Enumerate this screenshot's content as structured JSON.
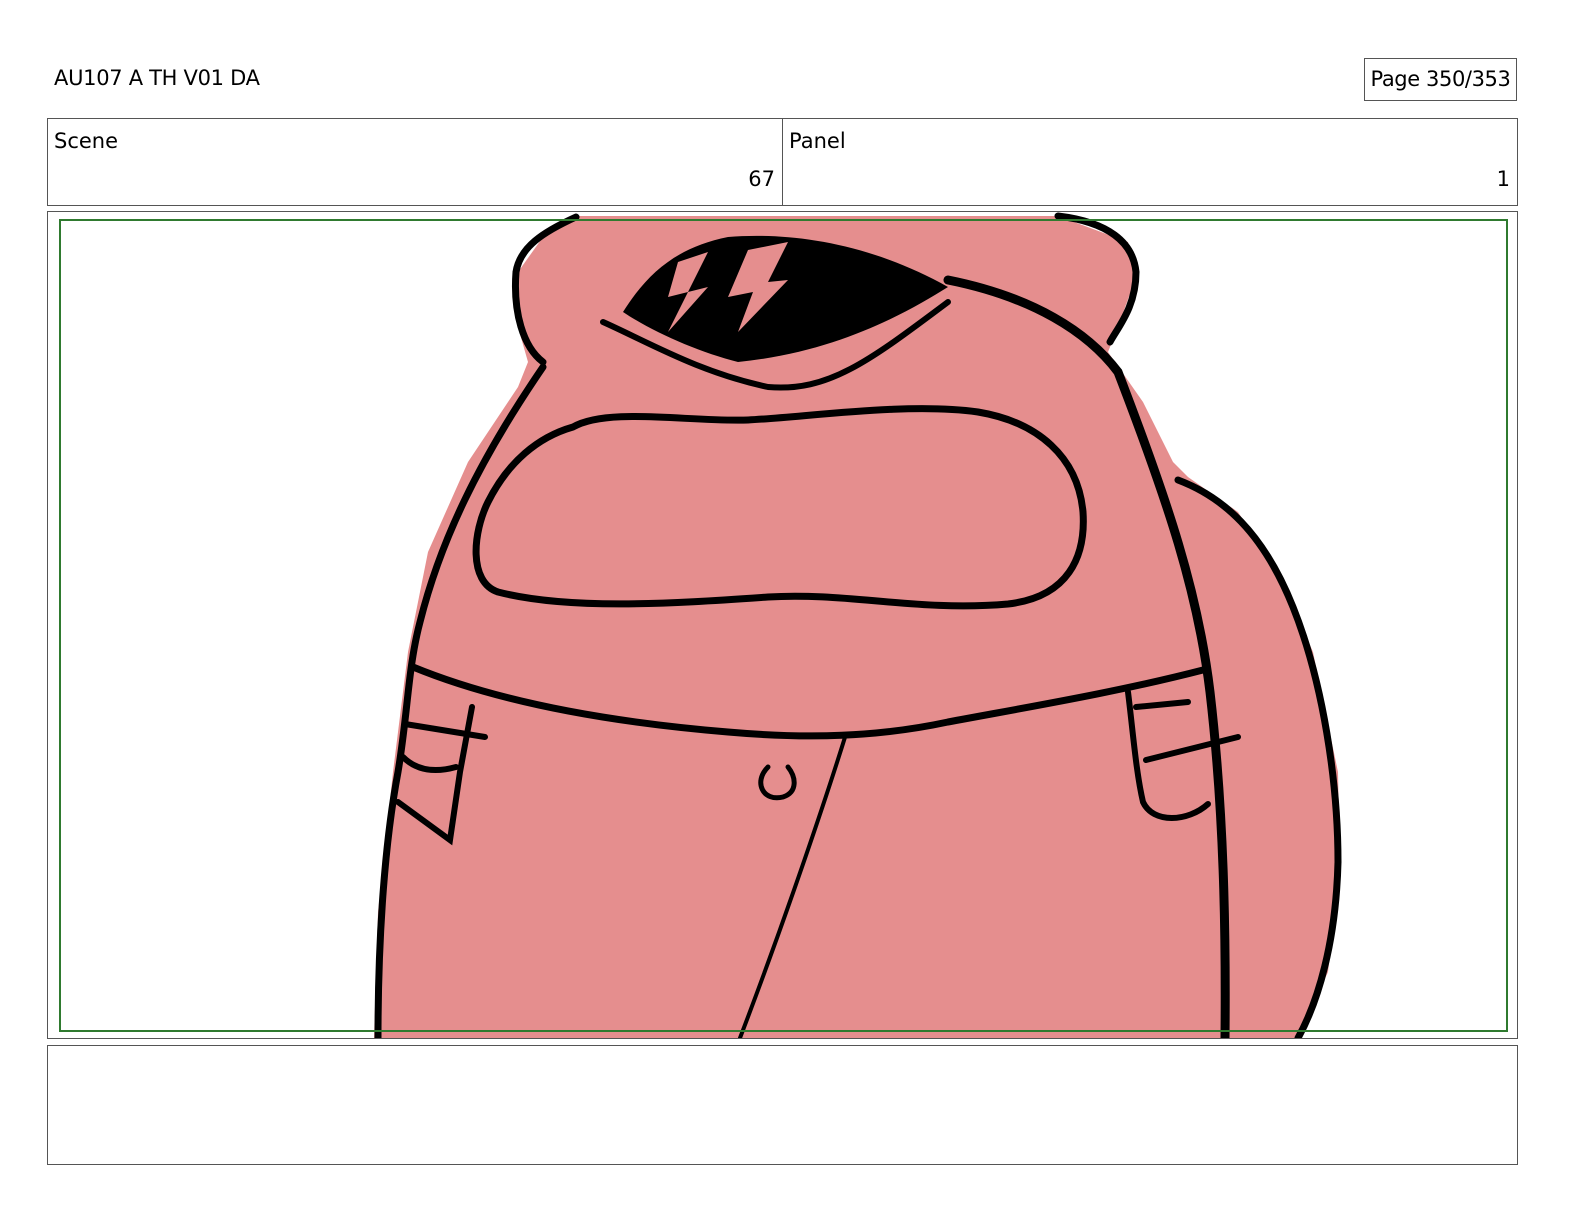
{
  "header": {
    "project_title": "AU107 A TH V01 DA",
    "page_label": "Page 350/353"
  },
  "info": {
    "scene_label": "Scene",
    "scene_value": "67",
    "panel_label": "Panel",
    "panel_value": "1"
  },
  "panel": {
    "subject_color": "#e58e8e",
    "visor_color": "#e58e8e",
    "line_color": "#000000",
    "safe_area_color": "#2f7a2f"
  },
  "notes": {
    "text": ""
  }
}
